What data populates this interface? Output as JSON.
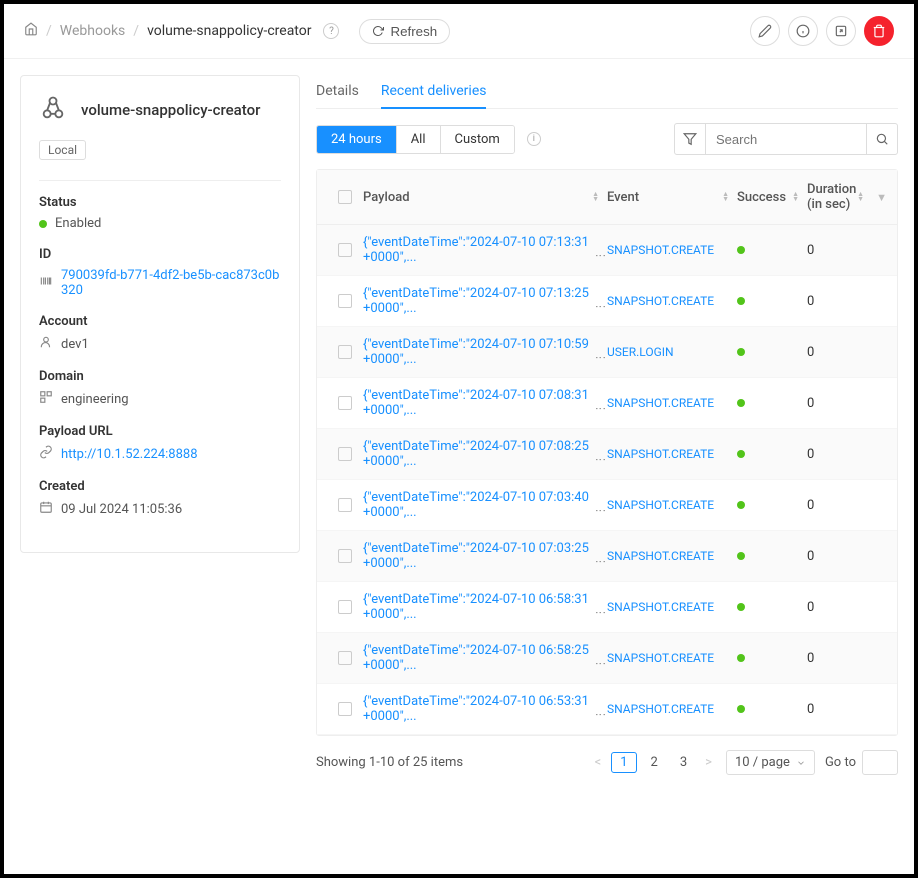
{
  "breadcrumb": {
    "webhooks": "Webhooks",
    "current": "volume-snappolicy-creator"
  },
  "refresh_label": "Refresh",
  "sidebar": {
    "title": "volume-snappolicy-creator",
    "local_badge": "Local",
    "status_label": "Status",
    "status_value": "Enabled",
    "id_label": "ID",
    "id_value": "790039fd-b771-4df2-be5b-cac873c0b320",
    "account_label": "Account",
    "account_value": "dev1",
    "domain_label": "Domain",
    "domain_value": "engineering",
    "payload_url_label": "Payload URL",
    "payload_url_value": "http://10.1.52.224:8888",
    "created_label": "Created",
    "created_value": "09 Jul 2024 11:05:36"
  },
  "tabs": {
    "details": "Details",
    "recent": "Recent deliveries"
  },
  "filters": {
    "t24": "24 hours",
    "all": "All",
    "custom": "Custom"
  },
  "search_placeholder": "Search",
  "columns": {
    "payload": "Payload",
    "event": "Event",
    "success": "Success",
    "duration": "Duration (in sec)"
  },
  "rows": [
    {
      "payload": "{\"eventDateTime\":\"2024-07-10 07:13:31 +0000\",...",
      "event": "SNAPSHOT.CREATE",
      "success": true,
      "duration": "0"
    },
    {
      "payload": "{\"eventDateTime\":\"2024-07-10 07:13:25 +0000\",...",
      "event": "SNAPSHOT.CREATE",
      "success": true,
      "duration": "0"
    },
    {
      "payload": "{\"eventDateTime\":\"2024-07-10 07:10:59 +0000\",...",
      "event": "USER.LOGIN",
      "success": true,
      "duration": "0"
    },
    {
      "payload": "{\"eventDateTime\":\"2024-07-10 07:08:31 +0000\",...",
      "event": "SNAPSHOT.CREATE",
      "success": true,
      "duration": "0"
    },
    {
      "payload": "{\"eventDateTime\":\"2024-07-10 07:08:25 +0000\",...",
      "event": "SNAPSHOT.CREATE",
      "success": true,
      "duration": "0"
    },
    {
      "payload": "{\"eventDateTime\":\"2024-07-10 07:03:40 +0000\",...",
      "event": "SNAPSHOT.CREATE",
      "success": true,
      "duration": "0"
    },
    {
      "payload": "{\"eventDateTime\":\"2024-07-10 07:03:25 +0000\",...",
      "event": "SNAPSHOT.CREATE",
      "success": true,
      "duration": "0"
    },
    {
      "payload": "{\"eventDateTime\":\"2024-07-10 06:58:31 +0000\",...",
      "event": "SNAPSHOT.CREATE",
      "success": true,
      "duration": "0"
    },
    {
      "payload": "{\"eventDateTime\":\"2024-07-10 06:58:25 +0000\",...",
      "event": "SNAPSHOT.CREATE",
      "success": true,
      "duration": "0"
    },
    {
      "payload": "{\"eventDateTime\":\"2024-07-10 06:53:31 +0000\",...",
      "event": "SNAPSHOT.CREATE",
      "success": true,
      "duration": "0"
    }
  ],
  "pagination": {
    "info": "Showing 1-10 of 25 items",
    "pages": [
      "1",
      "2",
      "3"
    ],
    "page_size": "10 / page",
    "goto_label": "Go to"
  }
}
